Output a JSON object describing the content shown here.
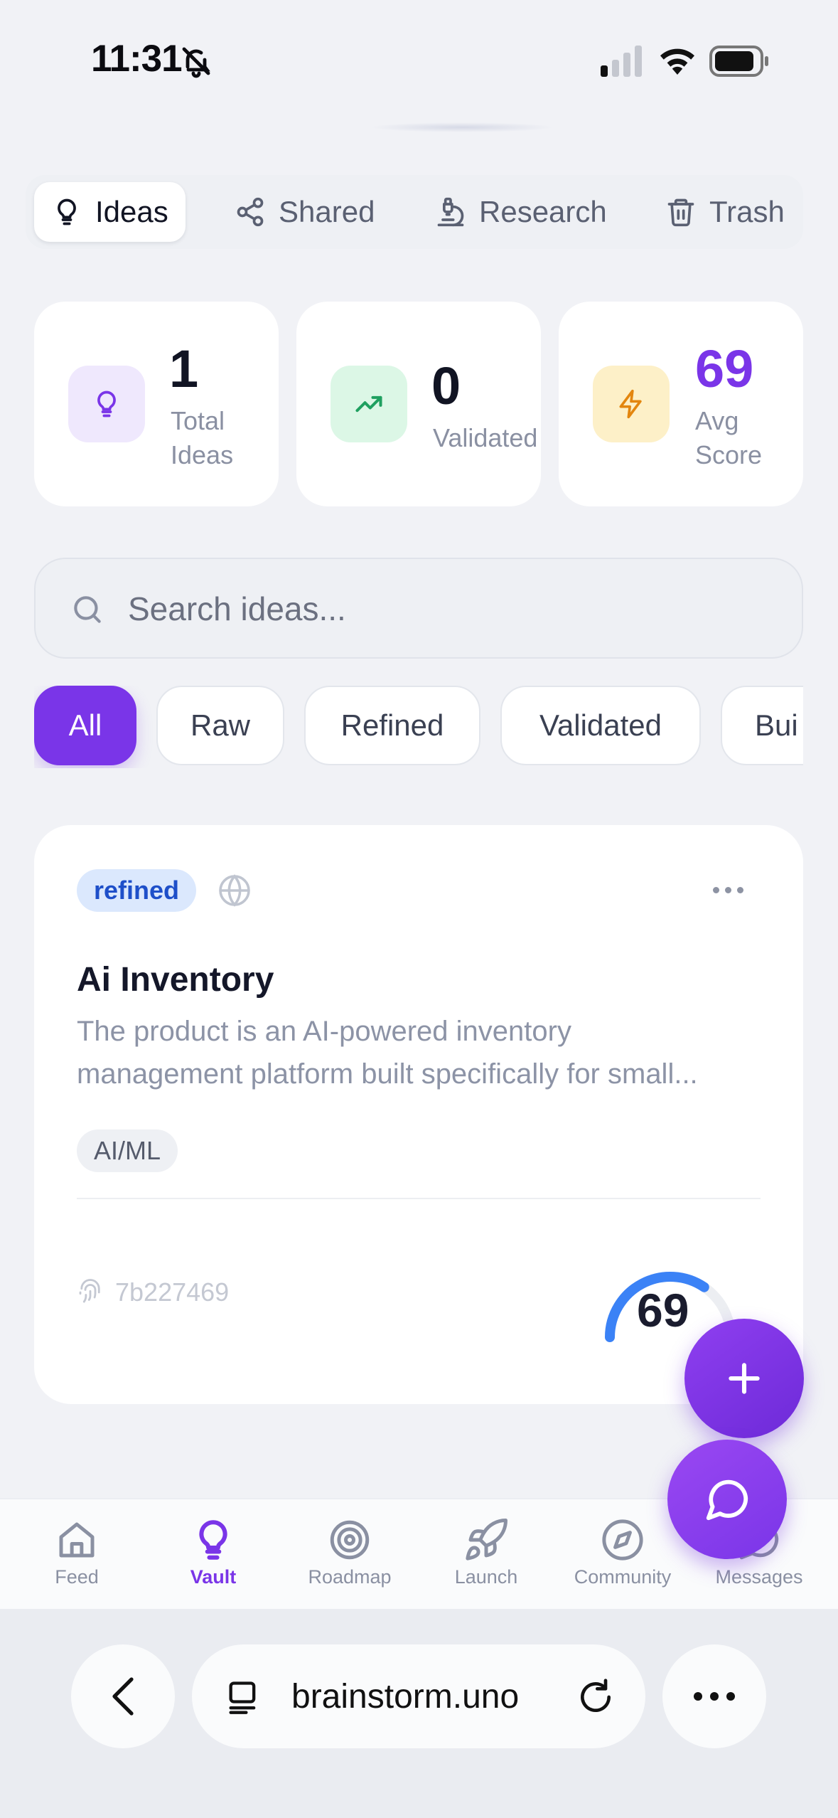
{
  "status_bar": {
    "time": "11:31"
  },
  "tabs": [
    {
      "label": "Ideas",
      "icon": "lightbulb-icon",
      "active": true
    },
    {
      "label": "Shared",
      "icon": "share-icon",
      "active": false
    },
    {
      "label": "Research",
      "icon": "microscope-icon",
      "active": false
    },
    {
      "label": "Trash",
      "icon": "trash-icon",
      "active": false
    }
  ],
  "stats": [
    {
      "value": "1",
      "label_line1": "Total",
      "label_line2": "Ideas",
      "icon": "lightbulb-icon",
      "color": "#7a35e8"
    },
    {
      "value": "0",
      "label_line1": "Validated",
      "label_line2": "",
      "icon": "trending-up-icon",
      "color": "#1fa060"
    },
    {
      "value": "69",
      "label_line1": "Avg",
      "label_line2": "Score",
      "icon": "lightning-icon",
      "color": "#7a35e8"
    }
  ],
  "search": {
    "placeholder": "Search ideas..."
  },
  "filters": [
    "All",
    "Raw",
    "Refined",
    "Validated",
    "Bui"
  ],
  "idea_card": {
    "status": "refined",
    "title": "Ai Inventory",
    "description_line1": "The product is an AI-powered inventory",
    "description_line2": "management platform built specifically for small...",
    "tag": "AI/ML",
    "id": "7b227469",
    "score": "69",
    "score_max": 100,
    "accent": "#3b82f6"
  },
  "bottom_nav": [
    {
      "label": "Feed",
      "icon": "home-icon",
      "active": false
    },
    {
      "label": "Vault",
      "icon": "lightbulb-icon",
      "active": true
    },
    {
      "label": "Roadmap",
      "icon": "target-icon",
      "active": false
    },
    {
      "label": "Launch",
      "icon": "rocket-icon",
      "active": false
    },
    {
      "label": "Community",
      "icon": "compass-icon",
      "active": false
    },
    {
      "label": "Messages",
      "icon": "chat-icon",
      "active": false
    }
  ],
  "browser": {
    "url": "brainstorm.uno"
  },
  "colors": {
    "brand": "#7a35e8",
    "background": "#f1f2f6"
  }
}
